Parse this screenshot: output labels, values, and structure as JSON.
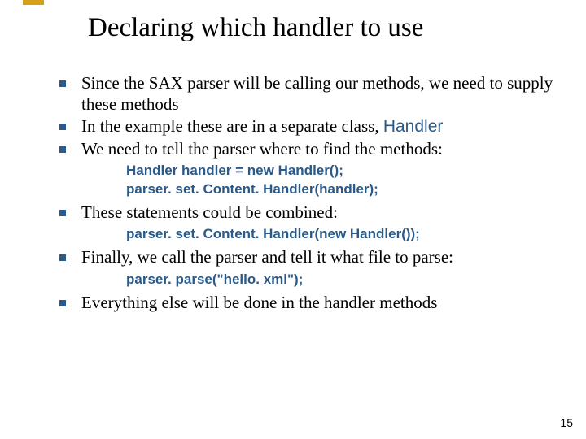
{
  "accent_color": "#d4a017",
  "bullet_color": "#2a5a8a",
  "code_color": "#2a5a8a",
  "title": "Declaring which handler to use",
  "bullets": {
    "b1": "Since the SAX parser will be calling our methods, we need to supply these methods",
    "b2a": "In the example these are in a separate class, ",
    "b2b": "Handler",
    "b3": "We need to tell the parser where to find the methods:",
    "b4": "These statements could be combined:",
    "b5": "Finally, we call the parser and tell it what file to parse:",
    "b6": "Everything else will be done in the handler methods"
  },
  "code": {
    "c1a": "Handler handler = new Handler();",
    "c1b": "parser. set. Content. Handler(handler);",
    "c2": "parser. set. Content. Handler(new Handler());",
    "c3": "parser. parse(\"hello. xml\");"
  },
  "page_number": "15"
}
